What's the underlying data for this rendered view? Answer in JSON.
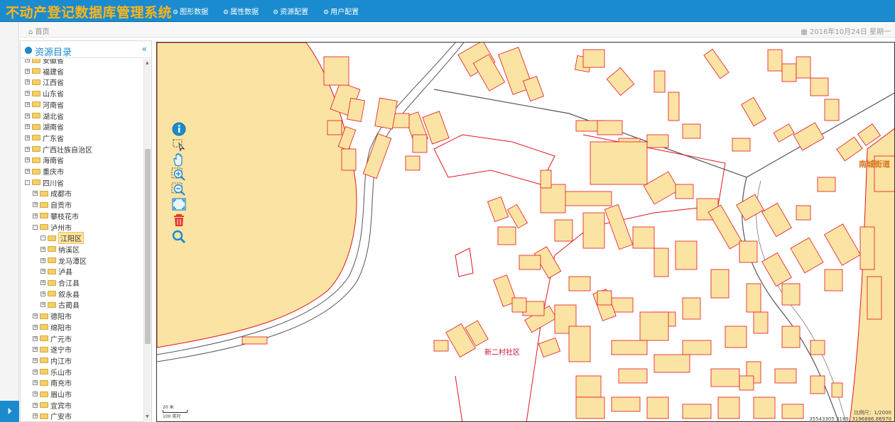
{
  "app": {
    "title": "不动产登记数据库管理系统"
  },
  "nav": [
    {
      "label": "图形数据"
    },
    {
      "label": "属性数据"
    },
    {
      "label": "资源配置"
    },
    {
      "label": "用户配置"
    }
  ],
  "breadcrumb": {
    "home": "首页"
  },
  "date": "2016年10月24日 星期一",
  "sidebar": {
    "title": "资源目录",
    "collapse_icon": "«",
    "tree": [
      {
        "label": "安徽省",
        "level": 0,
        "state": "+"
      },
      {
        "label": "福建省",
        "level": 0,
        "state": "+"
      },
      {
        "label": "江西省",
        "level": 0,
        "state": "+"
      },
      {
        "label": "山东省",
        "level": 0,
        "state": "+"
      },
      {
        "label": "河南省",
        "level": 0,
        "state": "+"
      },
      {
        "label": "湖北省",
        "level": 0,
        "state": "+"
      },
      {
        "label": "湖南省",
        "level": 0,
        "state": "+"
      },
      {
        "label": "广东省",
        "level": 0,
        "state": "+"
      },
      {
        "label": "广西壮族自治区",
        "level": 0,
        "state": "+"
      },
      {
        "label": "海南省",
        "level": 0,
        "state": "+"
      },
      {
        "label": "重庆市",
        "level": 0,
        "state": "+"
      },
      {
        "label": "四川省",
        "level": 0,
        "state": "-"
      },
      {
        "label": "成都市",
        "level": 1,
        "state": "+"
      },
      {
        "label": "自贡市",
        "level": 1,
        "state": "+"
      },
      {
        "label": "攀枝花市",
        "level": 1,
        "state": "+"
      },
      {
        "label": "泸州市",
        "level": 1,
        "state": "-"
      },
      {
        "label": "江阳区",
        "level": 2,
        "state": "-",
        "selected": true
      },
      {
        "label": "纳溪区",
        "level": 2,
        "state": "+"
      },
      {
        "label": "龙马潭区",
        "level": 2,
        "state": "+"
      },
      {
        "label": "泸县",
        "level": 2,
        "state": "+"
      },
      {
        "label": "合江县",
        "level": 2,
        "state": "+"
      },
      {
        "label": "叙永县",
        "level": 2,
        "state": "+"
      },
      {
        "label": "古蔺县",
        "level": 2,
        "state": "+"
      },
      {
        "label": "德阳市",
        "level": 1,
        "state": "+"
      },
      {
        "label": "绵阳市",
        "level": 1,
        "state": "+"
      },
      {
        "label": "广元市",
        "level": 1,
        "state": "+"
      },
      {
        "label": "遂宁市",
        "level": 1,
        "state": "+"
      },
      {
        "label": "内江市",
        "level": 1,
        "state": "+"
      },
      {
        "label": "乐山市",
        "level": 1,
        "state": "+"
      },
      {
        "label": "南充市",
        "level": 1,
        "state": "+"
      },
      {
        "label": "眉山市",
        "level": 1,
        "state": "+"
      },
      {
        "label": "宜宾市",
        "level": 1,
        "state": "+"
      },
      {
        "label": "广安市",
        "level": 1,
        "state": "+"
      }
    ]
  },
  "map": {
    "labels": {
      "community": "新二村社区",
      "street": "南城街道"
    },
    "scale": {
      "top": "20 米",
      "bottom": "100 英尺"
    },
    "ratio": "比例尺：1/2000",
    "coords": "35543305.3189, 3196886.86970",
    "tools": [
      "info-icon",
      "select-icon",
      "pan-hand-icon",
      "zoom-in-icon",
      "zoom-out-icon",
      "full-extent-icon",
      "clear-icon",
      "search-icon"
    ],
    "colors": {
      "parcel_fill": "#fbe3a3",
      "parcel_stroke": "#e2151f",
      "road": "#555555",
      "tool_blue": "#1a8bcf",
      "delete_red": "#e23b2f"
    }
  }
}
